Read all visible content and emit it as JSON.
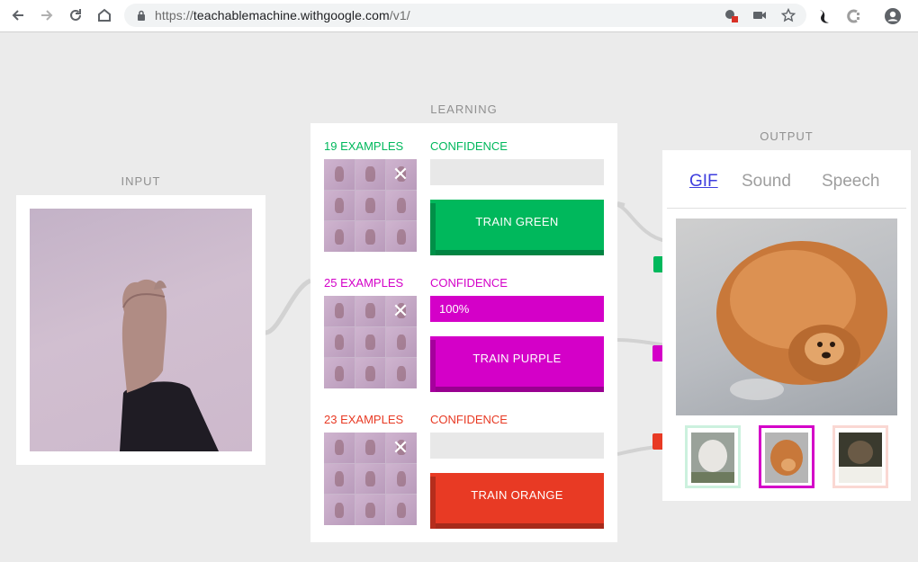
{
  "browser": {
    "url_scheme": "https://",
    "url_host": "teachablemachine.withgoogle.com",
    "url_path": "/v1/",
    "icons": [
      "back-icon",
      "forward-icon",
      "reload-icon",
      "home-icon",
      "lock-icon",
      "camera-blocked-icon",
      "video-icon",
      "star-icon",
      "extension-icon",
      "extension-icon",
      "account-icon"
    ]
  },
  "input": {
    "title": "INPUT"
  },
  "learning": {
    "title": "LEARNING",
    "classes": [
      {
        "examples": "19 EXAMPLES",
        "confidence_label": "CONFIDENCE",
        "confidence_value": 0,
        "confidence_text": "",
        "train_label": "TRAIN GREEN",
        "color": "#00b85c"
      },
      {
        "examples": "25 EXAMPLES",
        "confidence_label": "CONFIDENCE",
        "confidence_value": 1.0,
        "confidence_text": "100%",
        "train_label": "TRAIN PURPLE",
        "color": "#d400c8"
      },
      {
        "examples": "23 EXAMPLES",
        "confidence_label": "CONFIDENCE",
        "confidence_value": 0,
        "confidence_text": "",
        "train_label": "TRAIN ORANGE",
        "color": "#e83a24"
      }
    ]
  },
  "output": {
    "title": "OUTPUT",
    "tabs": [
      "GIF",
      "Sound",
      "Speech"
    ],
    "active_tab": "GIF",
    "selected_gif": 1
  },
  "colors": {
    "green": "#00b85c",
    "purple": "#d400c8",
    "orange": "#e83a24",
    "link": "#3d3dde"
  }
}
